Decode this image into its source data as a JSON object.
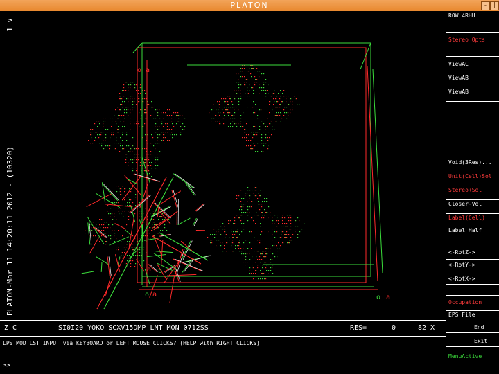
{
  "window": {
    "title": "PLATON",
    "minimize_glyph": "-",
    "close_glyph": "|"
  },
  "left_labels": {
    "top": "1 ∨",
    "main": "PLATON-Mar 11 14:20:11 2012 - (10320)"
  },
  "status_bar": {
    "axis": "Z  C",
    "info": "SI0I20 YOKO SCXV15DMP LNT MON 0712SS",
    "res": "RES=",
    "res_value": "0",
    "zoom": "82 X"
  },
  "message": "LPS MOD LST INPUT via KEYBOARD or LEFT MOUSE CLICKS? (HELP with RIGHT CLICKS)",
  "prompt": ">>",
  "right_panel": {
    "items": [
      {
        "label": "ROW  4RHU",
        "color": "#ffffff"
      },
      {
        "label": "Stereo Opts",
        "color": "#ff3b3b"
      },
      {
        "label": "ViewAC",
        "color": "#ffffff"
      },
      {
        "label": "ViewAB",
        "color": "#ffffff"
      },
      {
        "label": "ViewAB",
        "color": "#ffffff"
      },
      {
        "label": "Void(3Res)...",
        "color": "#ffffff"
      },
      {
        "label": "Unit(Cell)Sol",
        "color": "#ff3b3b"
      },
      {
        "label": "Stereo+Sol",
        "color": "#ff3b3b"
      },
      {
        "label": "Closer-Vol",
        "color": "#ffffff"
      },
      {
        "label": "Label(Cell)",
        "color": "#ff3b3b"
      },
      {
        "label": "Label  Half",
        "color": "#ffffff"
      },
      {
        "label": "<-RotZ->",
        "color": "#ffffff"
      },
      {
        "label": "<-RotY->",
        "color": "#ffffff"
      },
      {
        "label": "<-RotX->",
        "color": "#ffffff"
      },
      {
        "label": "Occupation",
        "color": "#ff3b3b"
      },
      {
        "label": "EPS File",
        "color": "#ffffff"
      },
      {
        "label": "End",
        "color": "#ffffff"
      },
      {
        "label": "Exit",
        "color": "#ffffff"
      },
      {
        "label": "MenuActive",
        "color": "#3bdc3b"
      }
    ]
  },
  "plot_labels": {
    "top_left_cell": "o a",
    "bottom_a": "a",
    "bottom_b": "b",
    "origin_left": "o",
    "origin_left_a": "a",
    "origin_right": "o",
    "origin_right_a": "a"
  },
  "colors": {
    "green": "#3bdc3b",
    "red": "#ff2a2a",
    "white": "#ffffff",
    "titlebar": "#e8882e"
  }
}
